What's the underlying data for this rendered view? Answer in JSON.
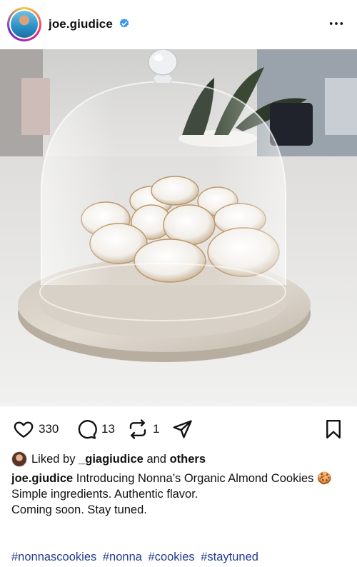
{
  "post": {
    "username": "joe.giudice",
    "verified_icon": "verified-badge-icon",
    "more_icon": "more-horizontal-icon",
    "image_alt": "Amaretti cookies under a glass dome on a marble tray"
  },
  "actions": {
    "like_count": "330",
    "comment_count": "13",
    "repost_count": "1"
  },
  "likes": {
    "prefix": "Liked by",
    "user": "_giagiudice",
    "connector": "and",
    "others": "others"
  },
  "caption": {
    "author": "joe.giudice",
    "line1": "Introducing Nonna’s Organic Almond Cookies 🍪",
    "line2": "Simple ingredients. Authentic flavor.",
    "line3": "Coming soon. Stay tuned."
  },
  "hashtags": [
    "#nonnascookies",
    "#nonna",
    "#cookies",
    "#staytuned"
  ],
  "colors": {
    "hashtag": "#243c8f",
    "verified": "#3897f0"
  }
}
